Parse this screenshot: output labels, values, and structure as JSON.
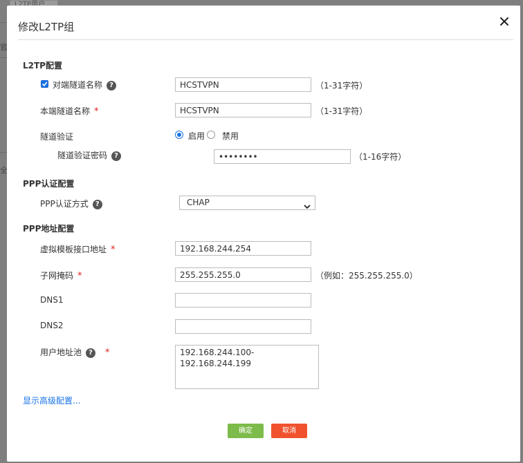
{
  "background": {
    "tab_label": "L2TP用户",
    "side_char_1": "官",
    "side_char_2": "全"
  },
  "dialog": {
    "title": "修改L2TP组",
    "close_icon": "close-icon"
  },
  "l2tp": {
    "section_title": "L2TP配置",
    "peer_tunnel_name": {
      "label": "对端隧道名称",
      "checked": true,
      "value": "HCSTVPN",
      "hint": "（1-31字符）"
    },
    "local_tunnel_name": {
      "label": "本端隧道名称",
      "required_mark": "*",
      "value": "HCSTVPN",
      "hint": "（1-31字符）"
    },
    "tunnel_auth": {
      "label": "隧道验证",
      "options": [
        "启用",
        "禁用"
      ],
      "selected": "启用"
    },
    "tunnel_auth_password": {
      "label": "隧道验证密码",
      "value": "••••••••",
      "hint": "（1-16字符）"
    }
  },
  "ppp_auth": {
    "section_title": "PPP认证配置",
    "mode_label": "PPP认证方式",
    "mode_value": "CHAP"
  },
  "ppp_addr": {
    "section_title": "PPP地址配置",
    "vt_address": {
      "label": "虚拟模板接口地址",
      "required_mark": "*",
      "value": "192.168.244.254"
    },
    "netmask": {
      "label": "子网掩码",
      "required_mark": "*",
      "value": "255.255.255.0",
      "hint": "（例如：255.255.255.0）"
    },
    "dns1": {
      "label": "DNS1",
      "value": ""
    },
    "dns2": {
      "label": "DNS2",
      "value": ""
    },
    "pool": {
      "label": "用户地址池",
      "required_mark": "*",
      "value": "192.168.244.100-192.168.244.199"
    }
  },
  "advanced_link": "显示高级配置...",
  "buttons": {
    "ok": "确定",
    "cancel": "取消"
  },
  "colors": {
    "accent": "#1a73e8",
    "ok_button": "#7dbb4a",
    "cancel_button": "#f0522e",
    "required": "#e02020"
  }
}
